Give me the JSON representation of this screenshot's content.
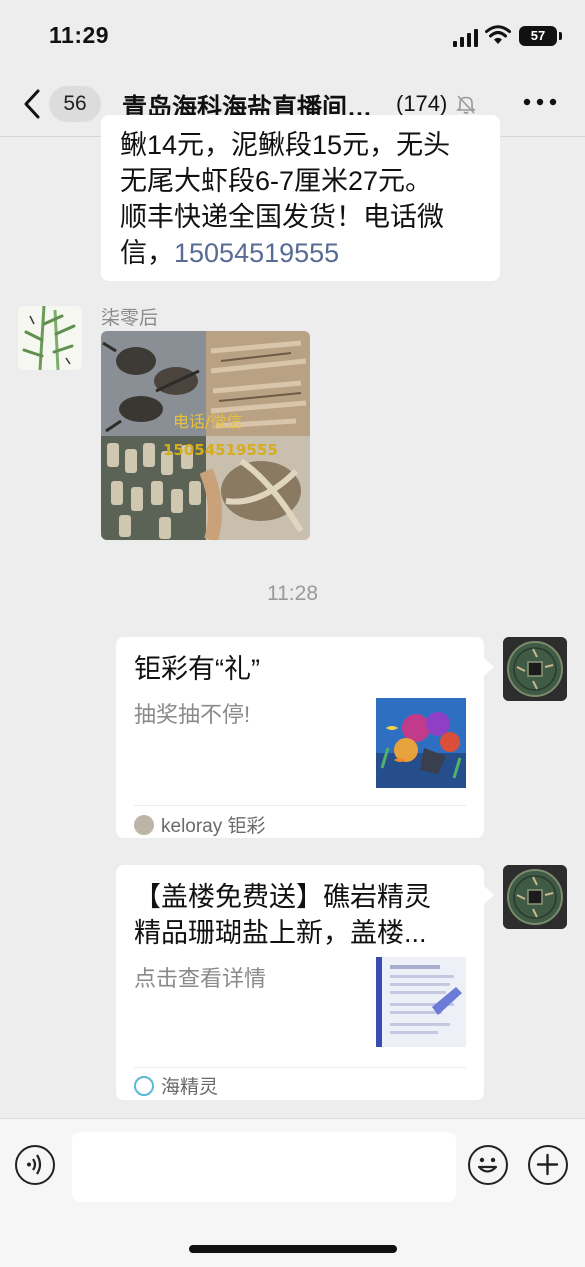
{
  "status_bar": {
    "time": "11:29",
    "battery": "57"
  },
  "nav": {
    "unread_count": "56",
    "title": "青岛海科海盐直播间（爆款推荐）",
    "member_count": "(174)"
  },
  "messages": {
    "text_message": {
      "lines": [
        "鳅14元，泥鳅段15元，无头",
        "无尾大虾段6-7厘米27元。",
        "顺丰快递全国发货！电话微"
      ],
      "last_prefix": "信，",
      "phone": "15054519555"
    },
    "photo_message": {
      "sender": "柒零后",
      "overlay_label": "电话/微信",
      "overlay_number": "15054519555"
    },
    "timestamp": "11:28",
    "card_1": {
      "title": "钜彩有“礼”",
      "description": "抽奖抽不停!",
      "source": "keloray 钜彩"
    },
    "card_2": {
      "title_line1": "【盖楼免费送】礁岩精灵",
      "title_line2": "精品珊瑚盐上新，盖楼...",
      "description": "点击查看详情",
      "source": "海精灵"
    }
  },
  "icons": {
    "back": "chevron-left-icon",
    "mute": "bell-slash-icon",
    "more": "ellipsis-icon",
    "voice": "voice-icon",
    "emoji": "emoji-icon",
    "plus": "plus-icon"
  },
  "colors": {
    "link": "#576b95",
    "background": "#ededed",
    "bubble": "#ffffff"
  }
}
